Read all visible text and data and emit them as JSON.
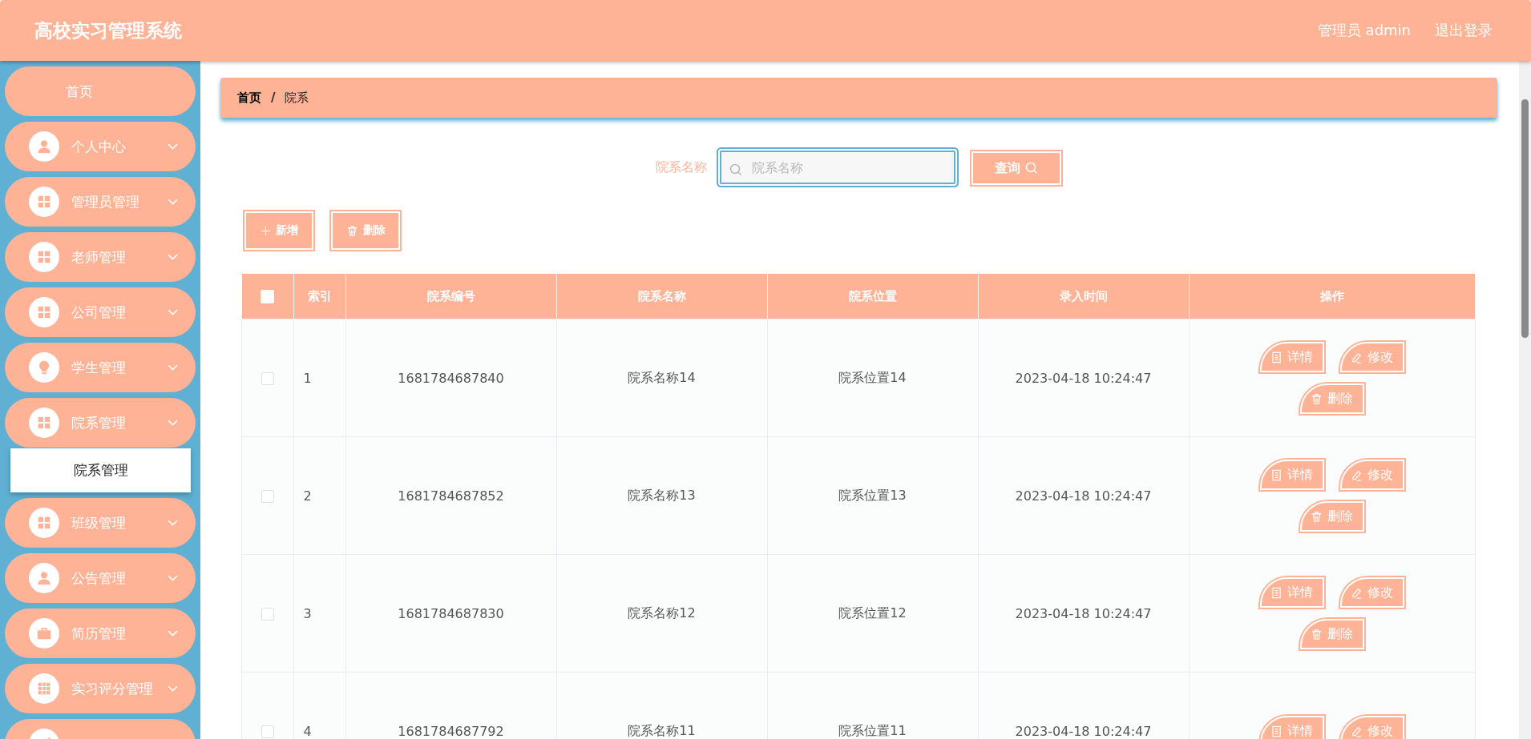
{
  "header": {
    "title": "高校实习管理系统",
    "user": "管理员 admin",
    "logout": "退出登录"
  },
  "sidebar": {
    "items": [
      {
        "label": "首页",
        "kind": "link"
      },
      {
        "label": "个人中心",
        "kind": "menu"
      },
      {
        "label": "管理员管理",
        "kind": "menu"
      },
      {
        "label": "老师管理",
        "kind": "menu"
      },
      {
        "label": "公司管理",
        "kind": "menu"
      },
      {
        "label": "学生管理",
        "kind": "menu"
      },
      {
        "label": "院系管理",
        "kind": "menu",
        "children": [
          {
            "label": "院系管理"
          }
        ]
      },
      {
        "label": "班级管理",
        "kind": "menu"
      },
      {
        "label": "公告管理",
        "kind": "menu"
      },
      {
        "label": "简历管理",
        "kind": "menu"
      },
      {
        "label": "实习评分管理",
        "kind": "menu"
      },
      {
        "kind": "partial"
      }
    ]
  },
  "breadcrumb": [
    "首页",
    "/",
    "院系"
  ],
  "search": {
    "label": "院系名称",
    "placeholder": "院系名称",
    "button": "查询"
  },
  "actions": [
    "新增",
    "删除"
  ],
  "table": {
    "select_all_checked": false,
    "columns": [
      "索引",
      "院系编号",
      "院系名称",
      "院系位置",
      "录入时间",
      "操作"
    ],
    "rows": [
      {
        "checked": false,
        "cells": [
          "1",
          "1681784687840",
          "院系名称14",
          "院系位置14",
          "2023-04-18 10:24:47"
        ],
        "buttons": [
          "详情",
          "修改",
          "删除"
        ]
      },
      {
        "checked": false,
        "cells": [
          "2",
          "1681784687852",
          "院系名称13",
          "院系位置13",
          "2023-04-18 10:24:47"
        ],
        "buttons": [
          "详情",
          "修改",
          "删除"
        ]
      },
      {
        "checked": false,
        "cells": [
          "3",
          "1681784687830",
          "院系名称12",
          "院系位置12",
          "2023-04-18 10:24:47"
        ],
        "buttons": [
          "详情",
          "修改",
          "删除"
        ]
      },
      {
        "checked": false,
        "cells": [
          "4",
          "1681784687792",
          "院系名称11",
          "院系位置11",
          "2023-04-18 10:24:47"
        ],
        "buttons": [
          "详情",
          "修改"
        ]
      }
    ]
  }
}
